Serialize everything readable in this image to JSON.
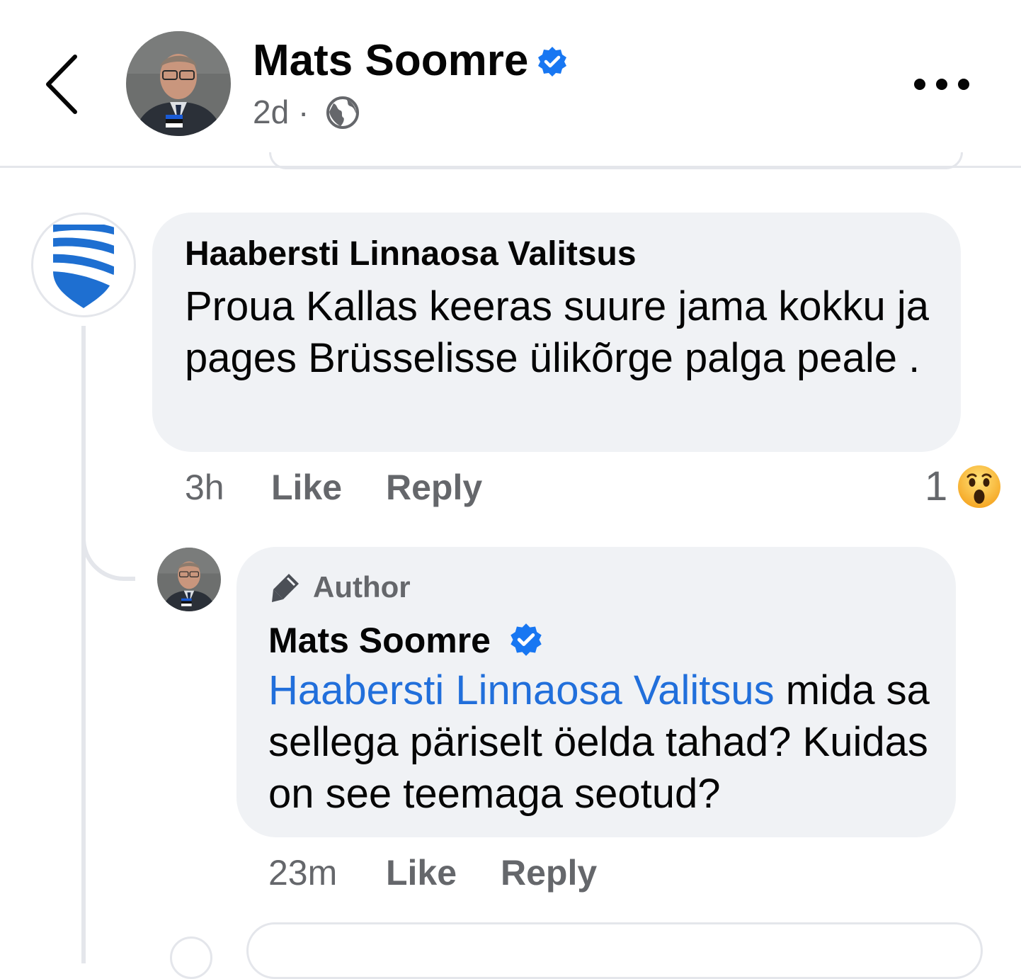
{
  "header": {
    "back_icon": "chevron-left-icon",
    "name": "Mats Soomre",
    "verified_icon": "verified-badge-icon",
    "time": "2d ·",
    "audience_icon": "globe-icon",
    "more_icon": "ellipsis-icon"
  },
  "comments": [
    {
      "author": "Haabersti Linnaosa Valitsus",
      "avatar_icon": "city-district-logo",
      "text": "Proua Kallas keeras suure jama kokku ja pages Brüsselisse ülikõrge palga peale .",
      "time": "3h",
      "like_label": "Like",
      "reply_label": "Reply",
      "reaction_count": "1",
      "reaction_icon": "wow-emoji-icon"
    },
    {
      "tag": "Author",
      "tag_icon": "pen-icon",
      "author": "Mats Soomre",
      "verified_icon": "verified-badge-icon",
      "mention": "Haabersti Linnaosa Valitsus",
      "text": " mida sa sellega päriselt öelda tahad? Kuidas on see teemaga seotud?",
      "time": "23m",
      "like_label": "Like",
      "reply_label": "Reply"
    }
  ],
  "colors": {
    "verified": "#1877f2",
    "mention": "#216fdb",
    "bubble": "#f0f2f5",
    "secondary_text": "#65676b"
  }
}
